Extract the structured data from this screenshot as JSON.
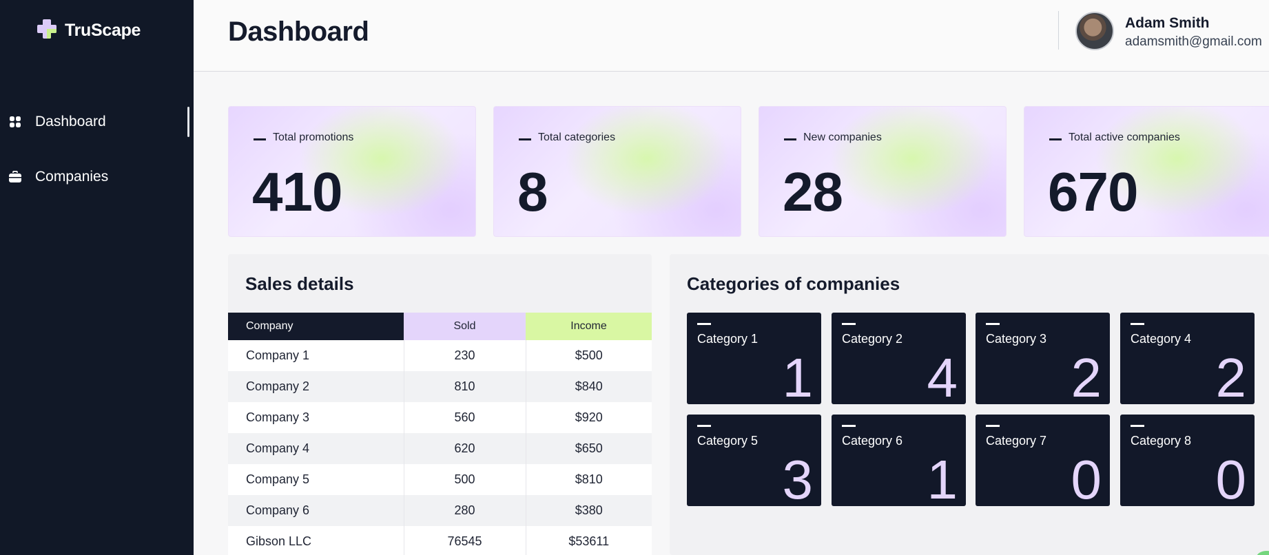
{
  "app": {
    "brand": "TruScape"
  },
  "sidebar": {
    "items": [
      {
        "label": "Dashboard",
        "icon": "grid-icon",
        "active": true
      },
      {
        "label": "Companies",
        "icon": "briefcase-icon",
        "active": false
      }
    ]
  },
  "header": {
    "title": "Dashboard",
    "user": {
      "name": "Adam Smith",
      "email": "adamsmith@gmail.com"
    }
  },
  "stats": [
    {
      "label": "Total promotions",
      "value": "410"
    },
    {
      "label": "Total categories",
      "value": "8"
    },
    {
      "label": "New companies",
      "value": "28"
    },
    {
      "label": "Total active companies",
      "value": "670"
    }
  ],
  "sales": {
    "title": "Sales details",
    "columns": [
      "Company",
      "Sold",
      "Income"
    ],
    "rows": [
      [
        "Company 1",
        "230",
        "$500"
      ],
      [
        "Company 2",
        "810",
        "$840"
      ],
      [
        "Company 3",
        "560",
        "$920"
      ],
      [
        "Company 4",
        "620",
        "$650"
      ],
      [
        "Company 5",
        "500",
        "$810"
      ],
      [
        "Company 6",
        "280",
        "$380"
      ],
      [
        "Gibson LLC",
        "76545",
        "$53611"
      ]
    ]
  },
  "categories": {
    "title": "Categories of companies",
    "items": [
      {
        "name": "Category 1",
        "value": "1"
      },
      {
        "name": "Category 2",
        "value": "4"
      },
      {
        "name": "Category 3",
        "value": "2"
      },
      {
        "name": "Category 4",
        "value": "2"
      },
      {
        "name": "Category 5",
        "value": "3"
      },
      {
        "name": "Category 6",
        "value": "1"
      },
      {
        "name": "Category 7",
        "value": "0"
      },
      {
        "name": "Category 8",
        "value": "0"
      }
    ]
  },
  "colors": {
    "sidebar_bg": "#111827",
    "accent_lavender": "#e4d5fb",
    "accent_lime": "#d9f7a3",
    "dark_tile": "#121829"
  }
}
